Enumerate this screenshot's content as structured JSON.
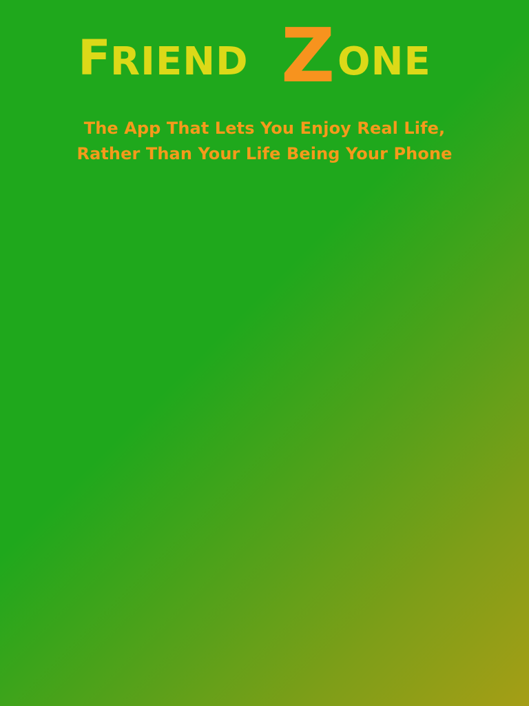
{
  "logo": {
    "text": "FriendZone",
    "part_before": "Friend",
    "part_highlight": "Z",
    "part_after": "one",
    "colors": {
      "main": "#dcd918",
      "highlight": "#f7931e"
    }
  },
  "tagline": {
    "line1": "The App That Lets You Enjoy Real Life,",
    "line2": "Rather Than Your Life Being Your Phone",
    "color": "#f59a1b"
  },
  "background": {
    "gradient_start": "#1fa81c",
    "gradient_end": "#a59e16"
  }
}
